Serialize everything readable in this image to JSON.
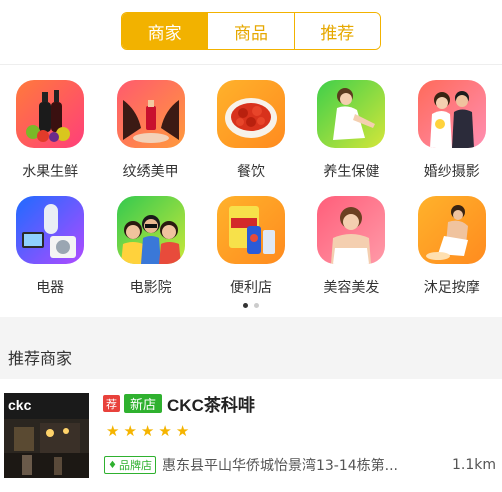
{
  "segment_tabs": [
    {
      "label": "商家",
      "active": true
    },
    {
      "label": "商品",
      "active": false
    },
    {
      "label": "推荐",
      "active": false
    }
  ],
  "categories": [
    {
      "label": "水果生鲜",
      "icon": "fruit-wine-icon"
    },
    {
      "label": "纹绣美甲",
      "icon": "nail-salon-icon"
    },
    {
      "label": "餐饮",
      "icon": "crayfish-food-icon"
    },
    {
      "label": "养生保健",
      "icon": "wellness-icon"
    },
    {
      "label": "婚纱摄影",
      "icon": "wedding-photo-icon"
    },
    {
      "label": "电器",
      "icon": "appliance-icon"
    },
    {
      "label": "电影院",
      "icon": "cinema-icon"
    },
    {
      "label": "便利店",
      "icon": "convenience-store-icon"
    },
    {
      "label": "美容美发",
      "icon": "beauty-salon-icon"
    },
    {
      "label": "沐足按摩",
      "icon": "foot-massage-icon"
    }
  ],
  "pagination": {
    "pages": 2,
    "current": 1
  },
  "section": {
    "title": "推荐商家"
  },
  "merchant": {
    "tag_recommend": "荐",
    "tag_new": "新店",
    "name": "CKC茶科啡",
    "rating": 5,
    "brand_badge": "品牌店",
    "address": "惠东县平山华侨城怡景湾13-14栋第...",
    "distance": "1.1km",
    "thumb_sign": "ckc"
  },
  "colors": {
    "accent": "#f2b200",
    "new_tag": "#2fb12f",
    "recommend_tag": "#e8413b",
    "star": "#f5b400"
  }
}
